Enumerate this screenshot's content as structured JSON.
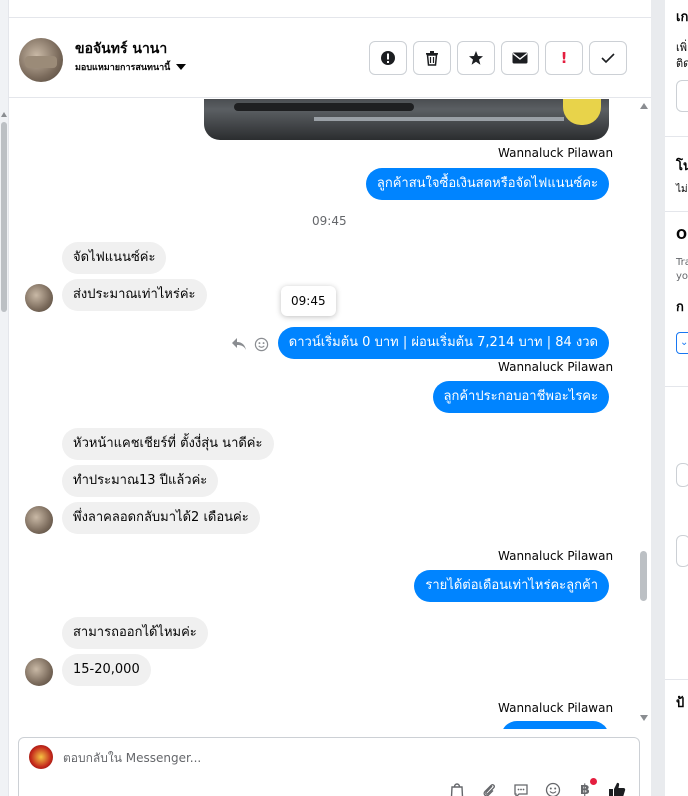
{
  "header": {
    "contact_name": "ขอจันทร์ นานา",
    "assign_label": "มอบแหมายการสนทนานี้",
    "actions": [
      {
        "name": "report-spam-button",
        "icon": "exclamation-circle-icon",
        "glyph": "❗"
      },
      {
        "name": "delete-button",
        "icon": "trash-icon",
        "glyph": "🗑"
      },
      {
        "name": "star-button",
        "icon": "star-icon",
        "glyph": "★"
      },
      {
        "name": "mark-unread-button",
        "icon": "envelope-icon",
        "glyph": "✉"
      },
      {
        "name": "follow-up-button",
        "icon": "red-exclamation-icon",
        "glyph": "!"
      },
      {
        "name": "mark-done-button",
        "icon": "check-icon",
        "glyph": "✓"
      }
    ]
  },
  "conversation": {
    "agent_name": "Wannaluck Pilawan",
    "time_divider": "09:45",
    "tooltip_time": "09:45",
    "messages": {
      "out1": "ลูกค้าสนใจซื้อเงินสดหรือจัดไฟแนนซ์คะ",
      "in1": "จัดไฟแนนซ์ค่ะ",
      "in2": "ส่งประมาณเท่าไหร่ค่ะ",
      "out2": "ดาวน์เริ่มต้น 0 บาท | ผ่อนเริ่มต้น 7,214 บาท | 84 งวด",
      "out3": "ลูกค้าประกอบอาชีพอะไรคะ",
      "in3": "หัวหน้าแคชเชียร์ที่ ตั้งงี่สุ่น นาดีค่ะ",
      "in4": "ทำประมาณ13 ปีแล้วค่ะ",
      "in5": "พึ่งลาคลอดกลับมาได้2 เดือนค่ะ",
      "out4": "รายได้ต่อเดือนเท่าไหร่คะลูกค้า",
      "in6": "สามารถออกได้ไหมค่ะ",
      "in7": "15-20,000"
    }
  },
  "composer": {
    "placeholder": "ตอบกลับใน Messenger...",
    "tools": [
      "shopping-bag-icon",
      "paperclip-icon",
      "saved-reply-icon",
      "emoji-icon",
      "payment-icon",
      "like-icon"
    ]
  },
  "right_panel": {
    "texts": [
      "เก",
      "เพิ่",
      "ติด",
      "โน",
      "ไม่",
      "O",
      "Tra",
      "yo",
      "ก",
      "ป้"
    ]
  },
  "colors": {
    "outgoing_bubble": "#0084ff",
    "incoming_bubble": "#f0f0f0",
    "alert_red": "#e41e3f"
  }
}
